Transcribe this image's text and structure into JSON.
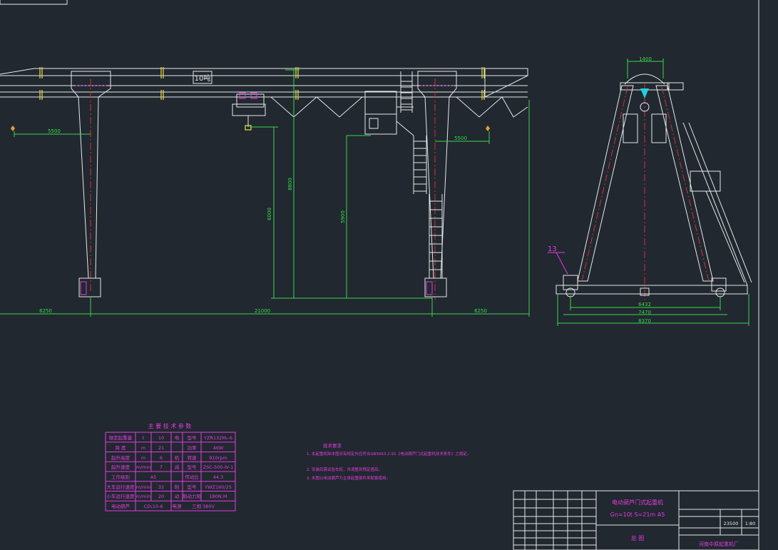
{
  "drawing": {
    "capacity_tag": "10吨",
    "callout": "13",
    "front_view_dims": {
      "left_overhang": "5500",
      "right_overhang": "5500",
      "left_cantilever": "6250",
      "span": "21000",
      "right_cantilever": "6250",
      "hook_height": "6000",
      "lift_height": "8800",
      "cab_height": "5900"
    },
    "side_view_dims": {
      "top": "1400",
      "wheel_base": "6432",
      "base1": "7470",
      "base2": "8370"
    }
  },
  "params_table": {
    "title": "主 要 技 术 参 数",
    "rows": [
      [
        "额定起重量",
        "t",
        "10"
      ],
      [
        "跨    度",
        "m",
        "21"
      ],
      [
        "起升高度",
        "m",
        "6"
      ],
      [
        "起升速度",
        "m/min",
        "7"
      ],
      [
        "工作级别",
        "A5",
        ""
      ],
      [
        "大车运行速度",
        "m/min",
        "32"
      ],
      [
        "小车运行速度",
        "m/min",
        "20"
      ],
      [
        "电动葫芦",
        "CD₁10-6",
        ""
      ]
    ],
    "right_rows": [
      [
        "电",
        "型号",
        "YZR132M₂-6"
      ],
      [
        "",
        "功率",
        "4KW"
      ],
      [
        "机",
        "转速",
        "910rpm"
      ],
      [
        "减",
        "型号",
        "ZSC-500-Ⅳ-1"
      ],
      [
        "",
        "传动比",
        "44.3"
      ],
      [
        "制",
        "型号",
        "YWZ160/25"
      ],
      [
        "动",
        "制动力矩",
        "180N.M"
      ],
      [
        "电源",
        "三相 380V",
        ""
      ]
    ]
  },
  "notes": {
    "title": "技术要求",
    "items": [
      "1. 本起重机除本图另有规定外应符合GB5663.2-91《电动葫芦门式起重机技术条件》之规定。",
      "2. 安装后需试验车轮，并调整到预定值后。",
      "3. 本图以电动葫芦为主体起重部件来配套使用。"
    ]
  },
  "title_block": {
    "product": "电动葫芦门式起重机",
    "spec": "Gn=10t  S=21m  A5",
    "drawing_name": "总    图",
    "weight": "23500",
    "scale": "1:80",
    "company": "河南中原起重机厂"
  }
}
